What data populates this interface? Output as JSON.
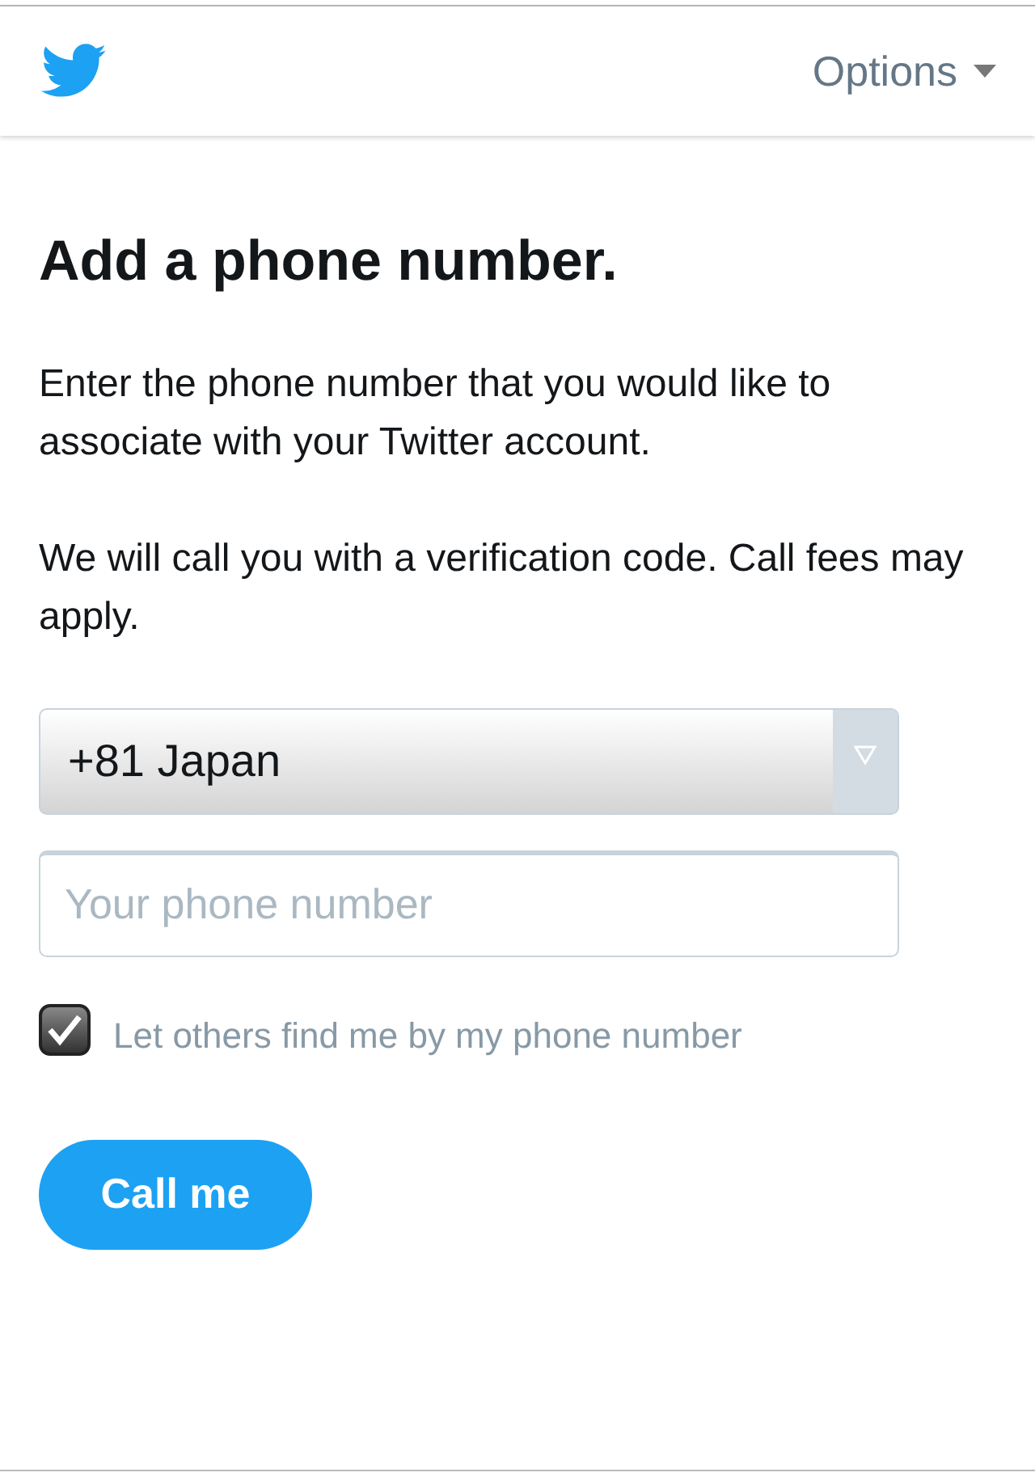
{
  "header": {
    "menu_label": "Options"
  },
  "title": "Add a phone number.",
  "paragraphs": [
    "Enter the phone number that you would like to associate with your Twitter account.",
    "We will call you with a verification code. Call fees may apply."
  ],
  "country_select": {
    "value": "+81 Japan"
  },
  "phone_field": {
    "placeholder": "Your phone number"
  },
  "discoverable": {
    "label": "Let others find me by my phone number",
    "checked": true
  },
  "submit_button": {
    "label": "Call me"
  }
}
